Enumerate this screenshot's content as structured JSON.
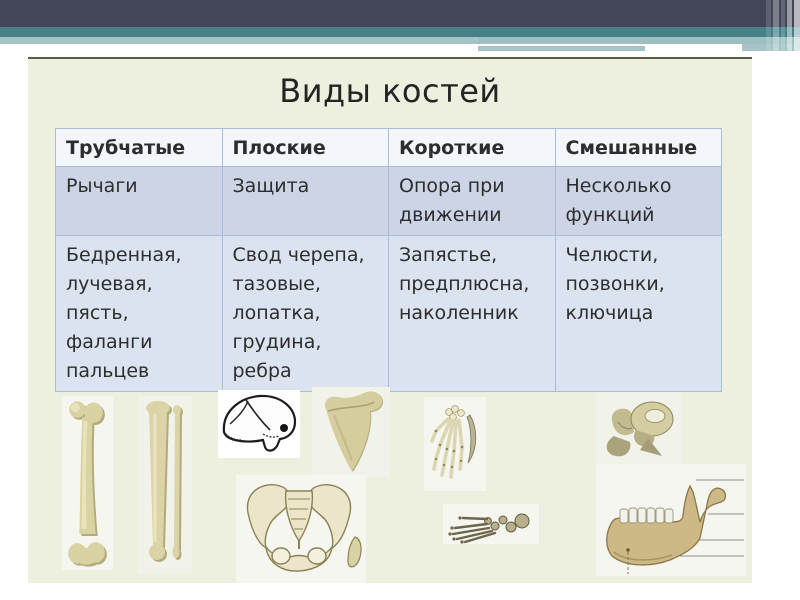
{
  "slide": {
    "title": "Виды костей"
  },
  "table": {
    "headers": [
      "Трубчатые",
      "Плоские",
      "Короткие",
      "Смешанные"
    ],
    "row_functions": [
      "Рычаги",
      "Защита",
      "Опора при\nдвижении",
      "Несколько\nфункций"
    ],
    "row_examples": [
      "Бедренная,\nлучевая,\nпясть,\nфаланги\nпальцев",
      "Свод черепа,\nтазовые,\nлопатка,\nгрудина,\nребра",
      "Запястье,\nпредплюсна,\nнаколенник",
      "Челюсти,\nпозвонки,\nключица"
    ]
  },
  "bone_images": [
    "femur-long-bone",
    "tibia-fibula-long-bones",
    "cranium-skull",
    "scapula",
    "pelvis",
    "hand-wrist-bones",
    "foot-bones",
    "vertebrae",
    "mandible-jaw"
  ],
  "colors": {
    "banner_navy": "#434659",
    "banner_teal": "#46818a",
    "banner_sage": "#a6c4c6",
    "slide_background": "#edf0de",
    "slide_top_border": "#5c5c47",
    "table_header_bg": "#f3f6fb",
    "table_row_functions_bg": "#ccd4e5",
    "table_row_examples_bg": "#dce3f0",
    "table_border": "#a9bed6",
    "text": "#2d2d2d",
    "bone_tan": "#d6cf9e"
  }
}
